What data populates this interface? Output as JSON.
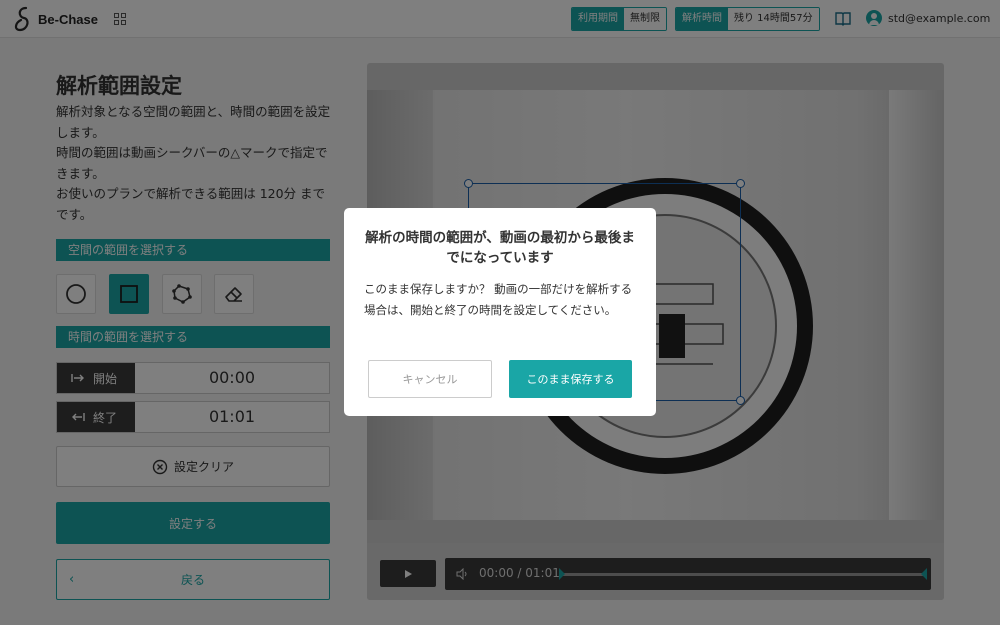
{
  "header": {
    "logo_text": "Be-Chase",
    "plan_period_label": "利用期間",
    "plan_period_value": "無制限",
    "analysis_time_label": "解析時間",
    "analysis_time_value": "残り 14時間57分",
    "user_email": "std@example.com"
  },
  "panel": {
    "title": "解析範囲設定",
    "desc": [
      "解析対象となる空間の範囲と、時間の範囲を設定します。",
      "時間の範囲は動画シークバーの△マークで指定できます。",
      "お使いのプランで解析できる範囲は 120分 までです。"
    ],
    "space_section": "空間の範囲を選択する",
    "time_section": "時間の範囲を選択する",
    "start_label": "開始",
    "start_value": "00:00",
    "end_label": "終了",
    "end_value": "01:01",
    "clear_label": "設定クリア",
    "set_label": "設定する",
    "back_label": "戻る"
  },
  "player": {
    "time_display": "00:00 / 01:01"
  },
  "dialog": {
    "title": "解析の時間の範囲が、動画の最初から最後までになっています",
    "body": "このまま保存しますか？ 動画の一部だけを解析する場合は、開始と終了の時間を設定してください。",
    "cancel_label": "キャンセル",
    "confirm_label": "このまま保存する"
  },
  "colors": {
    "accent": "#1aa6a6",
    "dark": "#3a3a3a"
  }
}
